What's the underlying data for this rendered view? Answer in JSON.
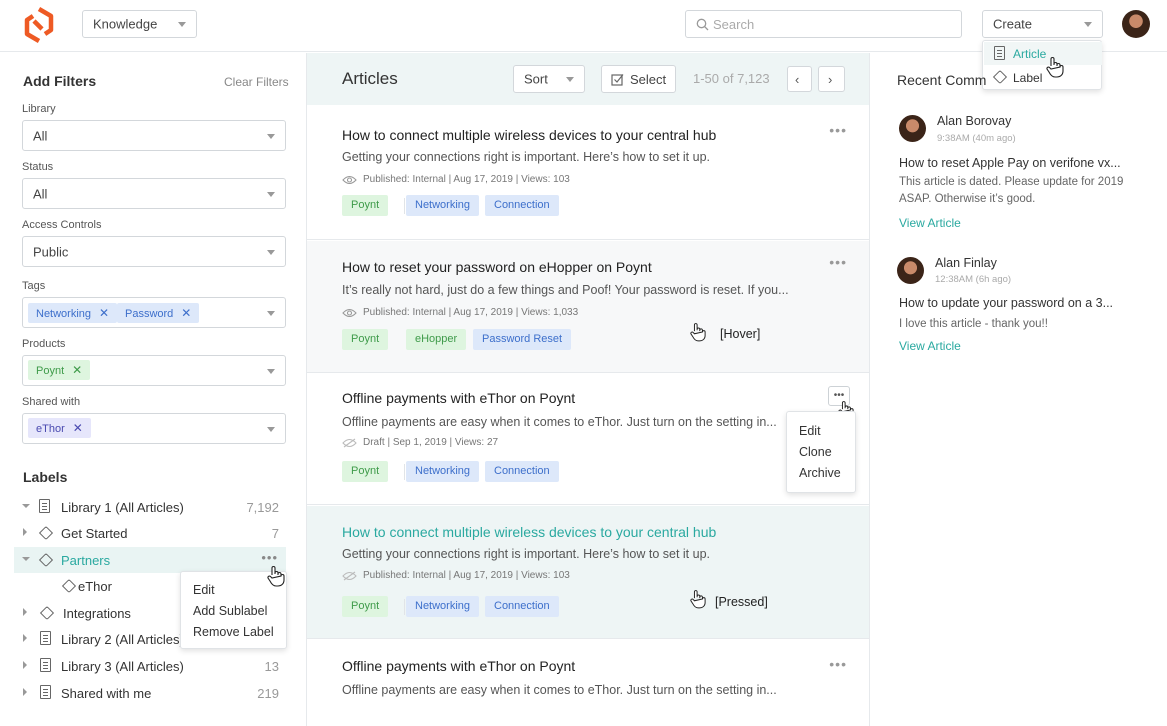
{
  "header": {
    "library_select": "Knowledge",
    "search_placeholder": "Search",
    "create_label": "Create",
    "create_menu": [
      "Article",
      "Label"
    ]
  },
  "filters": {
    "title": "Add Filters",
    "clear": "Clear Filters",
    "library_label": "Library",
    "library_value": "All",
    "status_label": "Status",
    "status_value": "All",
    "access_label": "Access Controls",
    "access_value": "Public",
    "tags_label": "Tags",
    "tags": [
      "Networking",
      "Password"
    ],
    "products_label": "Products",
    "products": [
      "Poynt"
    ],
    "shared_label": "Shared with",
    "shared": [
      "eThor"
    ]
  },
  "labels": {
    "title": "Labels",
    "items": [
      {
        "label": "Library 1 (All Articles)",
        "count": "7,192"
      },
      {
        "label": "Get Started",
        "count": "7"
      },
      {
        "label": "Partners",
        "count": ""
      },
      {
        "label": "eThor",
        "count": ""
      },
      {
        "label": "Integrations",
        "count": ""
      },
      {
        "label": "Library 2 (All Articles)",
        "count": ""
      },
      {
        "label": "Library 3 (All Articles)",
        "count": "13"
      },
      {
        "label": "Shared with me",
        "count": "219"
      }
    ],
    "context_menu": [
      "Edit",
      "Add Sublabel",
      "Remove Label"
    ]
  },
  "articles": {
    "title": "Articles",
    "sort": "Sort",
    "select": "Select",
    "range": "1-50 of 7,123",
    "items": [
      {
        "title": "How to connect multiple wireless devices to your central hub",
        "desc": "Getting your connections right is important. Here’s how to set it up.",
        "meta": "Published: Internal  |  Aug 17, 2019  |  Views: 103",
        "tags": [
          "Poynt",
          "Networking",
          "Connection"
        ]
      },
      {
        "title": "How to reset your password on eHopper on Poynt",
        "desc": "It’s really not hard, just do a few things and Poof! Your password is reset. If you...",
        "meta": "Published: Internal  |  Aug 17, 2019  |  Views: 1,033",
        "tags": [
          "Poynt",
          "eHopper",
          "Password Reset"
        ],
        "state": "[Hover]"
      },
      {
        "title": "Offline payments with eThor on Poynt",
        "desc": "Offline payments are easy when it comes to eThor. Just turn on the setting in...",
        "meta": "Draft  |  Sep 1, 2019  |  Views: 27",
        "tags": [
          "Poynt",
          "Networking",
          "Connection"
        ]
      },
      {
        "title": "How to connect multiple wireless devices to your central hub",
        "desc": "Getting your connections right is important. Here’s how to set it up.",
        "meta": "Published: Internal  |  Aug 17, 2019  |  Views: 103",
        "tags": [
          "Poynt",
          "Networking",
          "Connection"
        ],
        "state": "[Pressed]"
      },
      {
        "title": "Offline payments with eThor on Poynt",
        "desc": "Offline payments are easy when it comes to eThor. Just turn on the setting in..."
      }
    ],
    "card_menu": [
      "Edit",
      "Clone",
      "Archive"
    ]
  },
  "comments": {
    "title": "Recent Comm",
    "items": [
      {
        "name": "Alan Borovay",
        "time": "9:38AM (40m ago)",
        "article": "How to reset Apple Pay on verifone vx...",
        "text1": "This article is dated. Please update for 2019",
        "text2": "ASAP. Otherwise it’s good.",
        "link": "View Article"
      },
      {
        "name": "Alan Finlay",
        "time": "12:38AM (6h ago)",
        "article": "How to update your password on a 3...",
        "text1": "I love this article - thank you!!",
        "text2": "",
        "link": "View Article"
      }
    ]
  },
  "colors": {
    "accent": "#2aa9a0",
    "highlight": "#e9f4f3",
    "brand": "#ee5a24"
  }
}
